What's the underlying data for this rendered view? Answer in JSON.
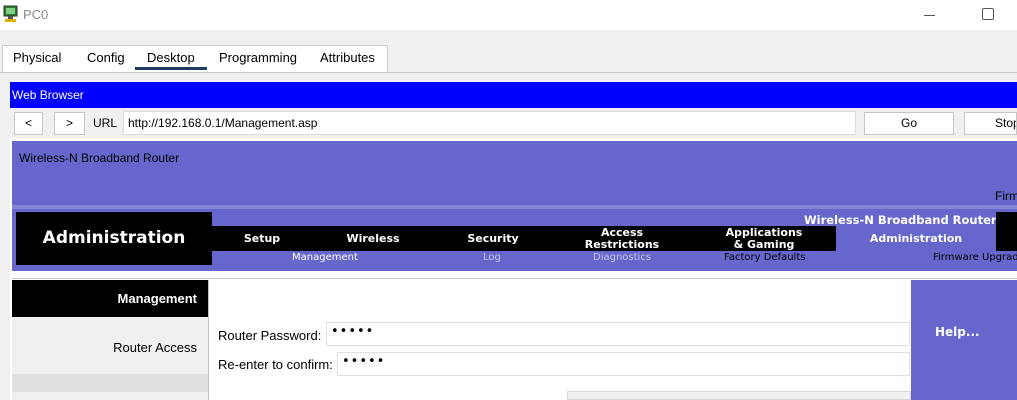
{
  "window": {
    "title": "PC0",
    "icon": "pc-monitor-icon",
    "controls": [
      "minimize-icon",
      "maximize-icon"
    ]
  },
  "tabs": [
    "Physical",
    "Config",
    "Desktop",
    "Programming",
    "Attributes"
  ],
  "active_tab": "Desktop",
  "browser": {
    "title": "Web Browser",
    "back_label": "<",
    "forward_label": ">",
    "url_label": "URL",
    "url": "http://192.168.0.1/Management.asp",
    "go_label": "Go",
    "stop_label": "Stop"
  },
  "router_page": {
    "router_name": "Wireless-N Broadband Router",
    "firmware_label": "Firmware Version",
    "section_title": "Administration",
    "product_label": "Wireless-N Broadband Router",
    "main_tabs": [
      {
        "label": "Setup"
      },
      {
        "label": "Wireless"
      },
      {
        "label": "Security"
      },
      {
        "label": "Access\nRestrictions"
      },
      {
        "label": "Applications\n& Gaming"
      },
      {
        "label": "Administration"
      }
    ],
    "active_main_tab": "Administration",
    "sub_tabs": [
      "Management",
      "Log",
      "Diagnostics",
      "Factory Defaults",
      "Firmware Upgrade"
    ],
    "active_sub_tab": "Management",
    "left_heading": "Management",
    "left_item": "Router Access",
    "password_label": "Router Password:",
    "password_value": "•••••",
    "confirm_label": "Re-enter to confirm:",
    "confirm_value": "•••••",
    "help_label": "Help..."
  },
  "colors": {
    "accent_blue": "#0000ff",
    "router_purple": "#6666cc",
    "active_subtab": "#ffffff",
    "inactive_subtab": "#c6c6ee"
  }
}
